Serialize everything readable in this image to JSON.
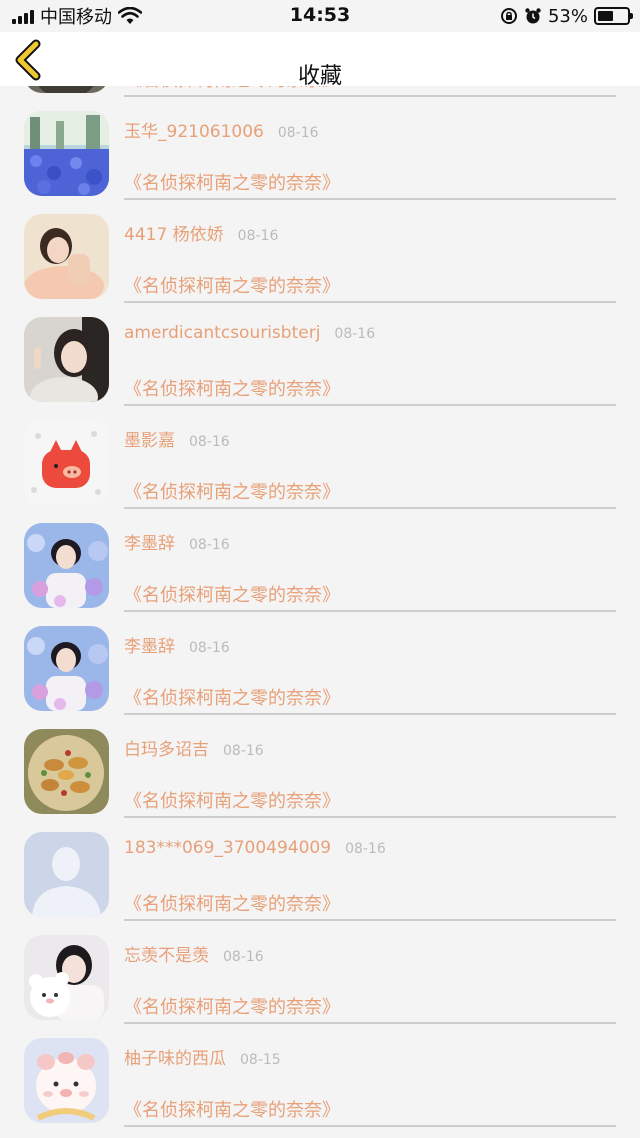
{
  "status_bar": {
    "carrier": "中国移动",
    "time": "14:53",
    "battery_percent": "53%",
    "battery_level": 0.53,
    "icons": [
      "signal-icon",
      "wifi-icon",
      "orientation-lock-icon",
      "alarm-icon",
      "battery-icon"
    ]
  },
  "nav": {
    "title": "收藏",
    "back_icon": "chevron-left-icon",
    "accent_color": "#f2c832"
  },
  "colors": {
    "name_text": "#e8a078",
    "date_text": "#bbbbbb",
    "divider": "#cdcdcd",
    "background": "#f4f4f4"
  },
  "favorites": [
    {
      "user": "",
      "date": "",
      "title": "《名侦探柯南之零的奈奈》",
      "avatar": "partial-avatar"
    },
    {
      "user": "玉华_921061006",
      "date": "08-16",
      "title": "《名侦探柯南之零的奈奈》",
      "avatar": "flower-field-avatar"
    },
    {
      "user": "4417 杨依娇",
      "date": "08-16",
      "title": "《名侦探柯南之零的奈奈》",
      "avatar": "girl-portrait-avatar"
    },
    {
      "user": "amerdicantcsourisbterj",
      "date": "08-16",
      "title": "《名侦探柯南之零的奈奈》",
      "avatar": "selfie-avatar"
    },
    {
      "user": "墨影嘉",
      "date": "08-16",
      "title": "《名侦探柯南之零的奈奈》",
      "avatar": "cartoon-pig-avatar"
    },
    {
      "user": "李墨辞",
      "date": "08-16",
      "title": "《名侦探柯南之零的奈奈》",
      "avatar": "portrait-flowers-avatar"
    },
    {
      "user": "李墨辞",
      "date": "08-16",
      "title": "《名侦探柯南之零的奈奈》",
      "avatar": "portrait-flowers-avatar"
    },
    {
      "user": "白玛多诏吉",
      "date": "08-16",
      "title": "《名侦探柯南之零的奈奈》",
      "avatar": "food-plate-avatar"
    },
    {
      "user": "183***069_3700494009",
      "date": "08-16",
      "title": "《名侦探柯南之零的奈奈》",
      "avatar": "default-user-avatar"
    },
    {
      "user": "忘羡不是羡",
      "date": "08-16",
      "title": "《名侦探柯南之零的奈奈》",
      "avatar": "girl-bear-avatar"
    },
    {
      "user": "柚子味的西瓜",
      "date": "08-15",
      "title": "《名侦探柯南之零的奈奈》",
      "avatar": "cartoon-piglet-avatar"
    }
  ]
}
